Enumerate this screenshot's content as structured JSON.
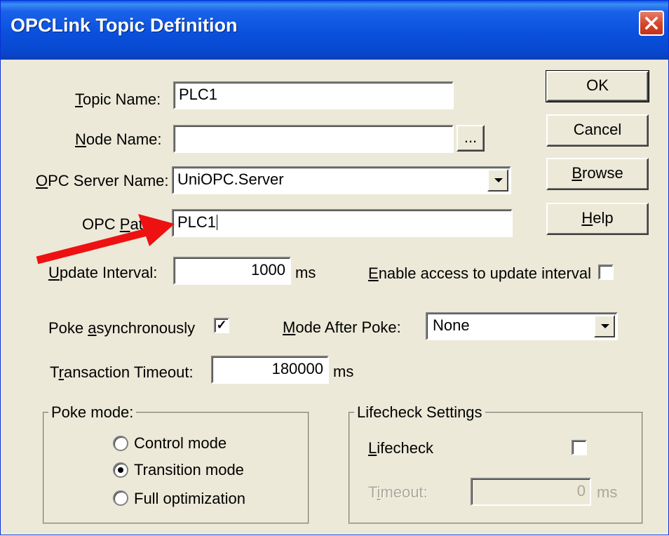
{
  "window": {
    "title": "OPCLink Topic Definition"
  },
  "fields": {
    "topic_name": {
      "label_pre": "",
      "label_u": "T",
      "label_post": "opic Name:",
      "value": "PLC1"
    },
    "node_name": {
      "label_pre": "",
      "label_u": "N",
      "label_post": "ode Name:",
      "value": "",
      "browse_label": "..."
    },
    "opc_server_name": {
      "label_pre": "",
      "label_u": "O",
      "label_post": "PC Server Name:",
      "value": "UniOPC.Server"
    },
    "opc_path": {
      "label_pre": "OPC ",
      "label_u": "P",
      "label_post": "ath:",
      "value": "PLC1"
    },
    "update_interval": {
      "label_pre": "",
      "label_u": "U",
      "label_post": "pdate Interval:",
      "value": "1000",
      "unit": "ms"
    },
    "enable_access": {
      "label_pre": "",
      "label_u": "E",
      "label_post": "nable access to update interval",
      "checked": false
    },
    "poke_async": {
      "label_pre": "Poke ",
      "label_u": "a",
      "label_post": "synchronously",
      "checked": true
    },
    "mode_after_poke": {
      "label_pre": "",
      "label_u": "M",
      "label_post": "ode After Poke:",
      "value": "None"
    },
    "transaction_timeout": {
      "label_pre": "T",
      "label_u": "r",
      "label_post": "ansaction Timeout:",
      "value": "180000",
      "unit": "ms"
    }
  },
  "buttons": {
    "ok": "OK",
    "cancel": "Cancel",
    "browse": {
      "pre": "",
      "u": "B",
      "post": "rowse"
    },
    "help": {
      "pre": "",
      "u": "H",
      "post": "elp"
    }
  },
  "poke_mode": {
    "title": "Poke mode:",
    "options": [
      {
        "label": "Control mode",
        "selected": false
      },
      {
        "label": "Transition mode",
        "selected": true
      },
      {
        "label": "Full optimization",
        "selected": false
      }
    ]
  },
  "lifecheck": {
    "title": "Lifecheck Settings",
    "lifecheck_label": {
      "pre": "",
      "u": "L",
      "post": "ifecheck"
    },
    "lifecheck_checked": false,
    "timeout_label": {
      "pre": "T",
      "u": "i",
      "post": "meout:"
    },
    "timeout_value": "0",
    "timeout_unit": "ms"
  },
  "annotation": {
    "arrow_color": "#ee1111"
  },
  "colors": {
    "title_bar": "#0a50dc",
    "dialog_bg": "#ece9d8",
    "close_button": "#d4452a"
  }
}
